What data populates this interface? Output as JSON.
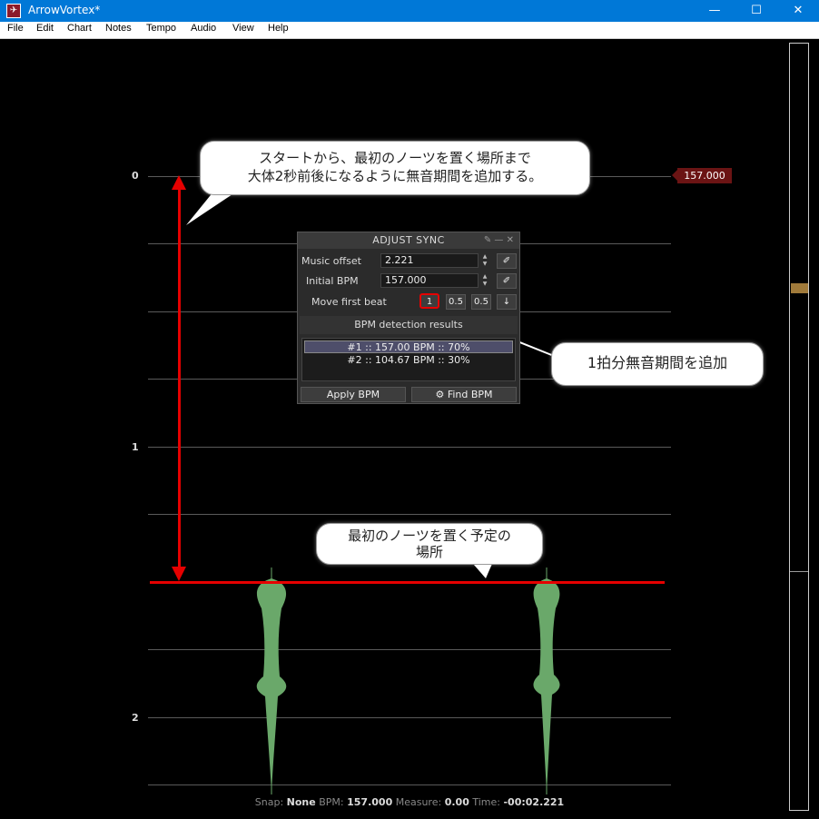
{
  "window": {
    "title": "ArrowVortex*",
    "minimize": "—",
    "maximize": "☐",
    "close": "✕"
  },
  "menu": [
    "File",
    "Edit",
    "Chart",
    "Notes",
    "Tempo",
    "Audio",
    "View",
    "Help"
  ],
  "measures": [
    "0",
    "1",
    "2"
  ],
  "bpm_tag": "157.000",
  "dialog": {
    "title": "ADJUST SYNC",
    "music_offset_label": "Music offset",
    "music_offset_value": "2.221",
    "initial_bpm_label": "Initial BPM",
    "initial_bpm_value": "157.000",
    "move_first_beat_label": "Move first beat",
    "move_buttons": [
      "1",
      "0.5",
      "0.5",
      "↓"
    ],
    "results_title": "BPM detection results",
    "results": [
      "#1 :: 157.00 BPM :: 70%",
      "#2 :: 104.67 BPM :: 30%"
    ],
    "apply_label": "Apply BPM",
    "find_label": "Find BPM"
  },
  "callouts": {
    "top_line1": "スタートから、最初のノーツを置く場所まで",
    "top_line2": "大体2秒前後になるように無音期間を追加する。",
    "right": "1拍分無音期間を追加",
    "bottom_line1": "最初のノーツを置く予定の",
    "bottom_line2": "場所"
  },
  "status": {
    "snap_label": "Snap:",
    "snap_value": "None",
    "bpm_label": "BPM:",
    "bpm_value": "157.000",
    "measure_label": "Measure:",
    "measure_value": "0.00",
    "time_label": "Time:",
    "time_value": "-00:02.221"
  },
  "colors": {
    "titlebar": "#0078d7",
    "annotation_red": "#e60000",
    "waveform": "#6aa86a",
    "bpm_tag": "#6b1414"
  }
}
